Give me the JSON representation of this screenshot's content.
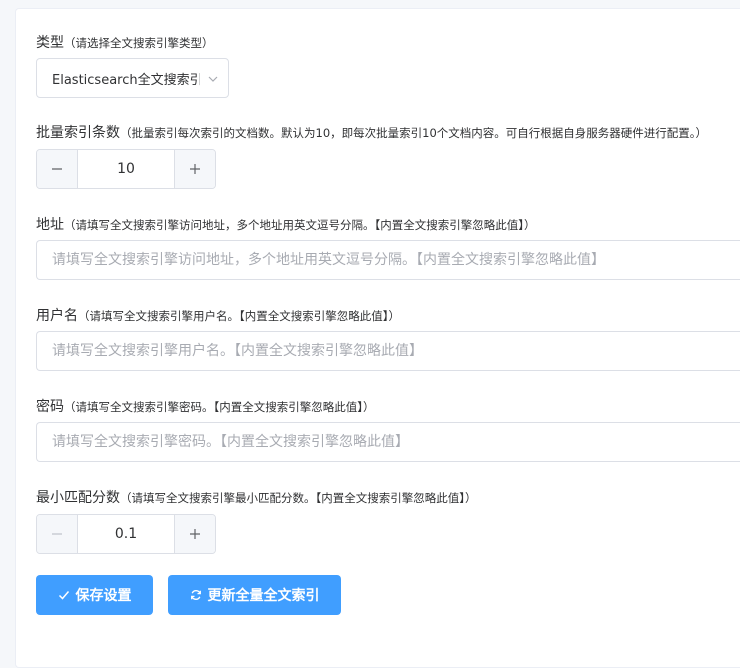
{
  "type_field": {
    "label": "类型",
    "hint": "（请选择全文搜索引擎类型）",
    "selected": "Elasticsearch全文搜索引擎"
  },
  "batch_field": {
    "label": "批量索引条数",
    "hint": "（批量索引每次索引的文档数。默认为10，即每次批量索引10个文档内容。可自行根据自身服务器硬件进行配置。）",
    "value": "10"
  },
  "address_field": {
    "label": "地址",
    "hint": "（请填写全文搜索引擎访问地址，多个地址用英文逗号分隔。【内置全文搜索引擎忽略此值】）",
    "placeholder": "请填写全文搜索引擎访问地址，多个地址用英文逗号分隔。【内置全文搜索引擎忽略此值】"
  },
  "username_field": {
    "label": "用户名",
    "hint": "（请填写全文搜索引擎用户名。【内置全文搜索引擎忽略此值】）",
    "placeholder": "请填写全文搜索引擎用户名。【内置全文搜索引擎忽略此值】"
  },
  "password_field": {
    "label": "密码",
    "hint": "（请填写全文搜索引擎密码。【内置全文搜索引擎忽略此值】）",
    "placeholder": "请填写全文搜索引擎密码。【内置全文搜索引擎忽略此值】"
  },
  "min_score_field": {
    "label": "最小匹配分数",
    "hint": "（请填写全文搜索引擎最小匹配分数。【内置全文搜索引擎忽略此值】）",
    "value": "0.1"
  },
  "actions": {
    "save_label": "保存设置",
    "save_icon": "check-icon",
    "rebuild_label": "更新全量全文索引",
    "rebuild_icon": "refresh-icon",
    "primary_color": "#409eff"
  }
}
